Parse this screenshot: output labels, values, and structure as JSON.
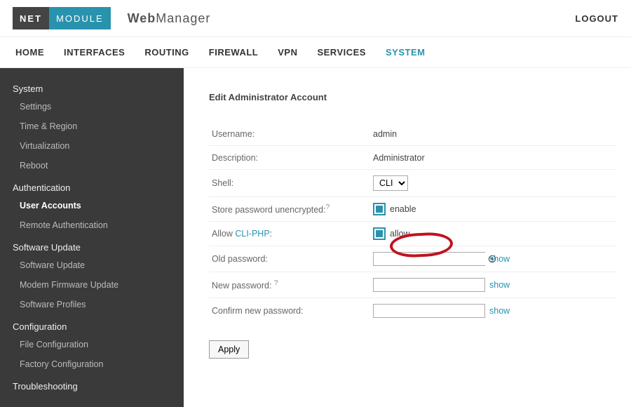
{
  "header": {
    "logo_left": "NET",
    "logo_right": "MODULE",
    "brand_bold": "Web",
    "brand_rest": "Manager",
    "logout": "LOGOUT"
  },
  "mainnav": {
    "items": [
      "HOME",
      "INTERFACES",
      "ROUTING",
      "FIREWALL",
      "VPN",
      "SERVICES",
      "SYSTEM"
    ],
    "active_index": 6
  },
  "sidebar": {
    "groups": [
      {
        "title": "System",
        "items": [
          "Settings",
          "Time & Region",
          "Virtualization",
          "Reboot"
        ],
        "active_index": -1
      },
      {
        "title": "Authentication",
        "items": [
          "User Accounts",
          "Remote Authentication"
        ],
        "active_index": 0
      },
      {
        "title": "Software Update",
        "items": [
          "Software Update",
          "Modem Firmware Update",
          "Software Profiles"
        ],
        "active_index": -1
      },
      {
        "title": "Configuration",
        "items": [
          "File Configuration",
          "Factory Configuration"
        ],
        "active_index": -1
      },
      {
        "title": "Troubleshooting",
        "items": [],
        "active_index": -1
      }
    ]
  },
  "page": {
    "title": "Edit Administrator Account",
    "rows": {
      "username": {
        "label": "Username:",
        "value": "admin"
      },
      "description": {
        "label": "Description:",
        "value": "Administrator"
      },
      "shell": {
        "label": "Shell:",
        "selected": "CLI"
      },
      "store_pw": {
        "label": "Store password unencrypted:",
        "help": "?",
        "cb_label": "enable"
      },
      "allow_cliphp": {
        "label_prefix": "Allow ",
        "label_link": "CLI-PHP",
        "label_suffix": ":",
        "cb_label": "allow"
      },
      "old_pw": {
        "label": "Old password:",
        "show": "show"
      },
      "new_pw": {
        "label": "New password:",
        "help": "?",
        "show": "show"
      },
      "confirm_pw": {
        "label": "Confirm new password:",
        "show": "show"
      }
    },
    "apply": "Apply"
  }
}
